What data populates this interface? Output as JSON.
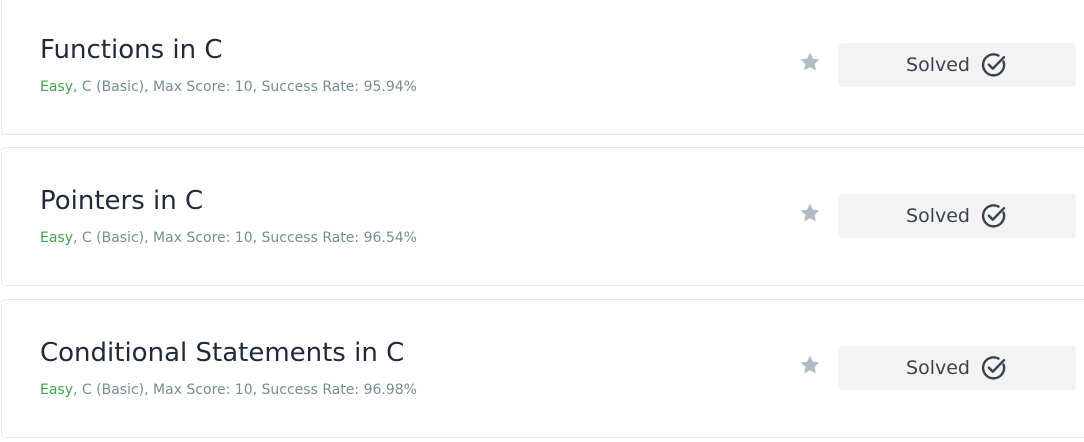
{
  "challenges": [
    {
      "title": "Functions in C",
      "difficulty": "Easy",
      "meta_rest": ", C (Basic), Max Score: 10, Success Rate: 95.94%",
      "status_label": "Solved"
    },
    {
      "title": "Pointers in C",
      "difficulty": "Easy",
      "meta_rest": ", C (Basic), Max Score: 10, Success Rate: 96.54%",
      "status_label": "Solved"
    },
    {
      "title": "Conditional Statements in C",
      "difficulty": "Easy",
      "meta_rest": ", C (Basic), Max Score: 10, Success Rate: 96.98%",
      "status_label": "Solved"
    }
  ],
  "icons": {
    "bookmark": "star-icon",
    "status": "check-circle-icon"
  },
  "colors": {
    "difficulty_easy": "#39a74b",
    "meta_text": "#738f93",
    "title_text": "#1f2a3a",
    "star": "#b0bcc4",
    "button_bg": "#f3f3f3",
    "button_text": "#39424e"
  }
}
